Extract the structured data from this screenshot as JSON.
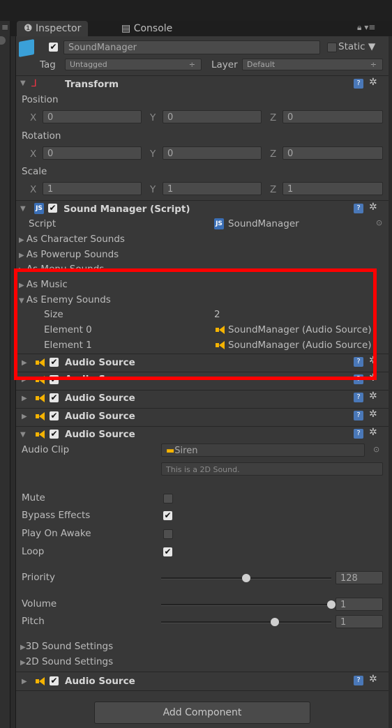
{
  "tabs": {
    "inspector": "Inspector",
    "console": "Console"
  },
  "window_icons": {
    "lock": "lock-icon",
    "menu": "menu-icon"
  },
  "gameobject": {
    "name": "SoundManager",
    "static_label": "Static",
    "tag_label": "Tag",
    "tag_value": "Untagged",
    "layer_label": "Layer",
    "layer_value": "Default"
  },
  "transform": {
    "title": "Transform",
    "position_label": "Position",
    "rotation_label": "Rotation",
    "scale_label": "Scale",
    "x": "X",
    "y": "Y",
    "z": "Z",
    "position": [
      "0",
      "0",
      "0"
    ],
    "rotation": [
      "0",
      "0",
      "0"
    ],
    "scale": [
      "1",
      "1",
      "1"
    ]
  },
  "script_component": {
    "title": "Sound Manager (Script)",
    "script_label": "Script",
    "script_value": "SoundManager",
    "js_badge": "JS",
    "items": [
      "As Character Sounds",
      "As Powerup Sounds",
      "As Menu Sounds",
      "As Music",
      "As Enemy Sounds"
    ],
    "size_label": "Size",
    "size_value": "2",
    "element0_label": "Element 0",
    "element0_value": "SoundManager (Audio Source)",
    "element1_label": "Element 1",
    "element1_value": "SoundManager (Audio Source)"
  },
  "audio_source_label": "Audio Source",
  "audio": {
    "clip_label": "Audio Clip",
    "clip_value": "Siren",
    "clip_note": "This is a 2D Sound.",
    "mute": "Mute",
    "bypass": "Bypass Effects",
    "play_on_awake": "Play On Awake",
    "loop": "Loop",
    "mute_checked": false,
    "bypass_checked": true,
    "play_on_awake_checked": false,
    "loop_checked": true,
    "priority_label": "Priority",
    "priority_value": "128",
    "volume_label": "Volume",
    "volume_value": "1",
    "pitch_label": "Pitch",
    "pitch_value": "1",
    "sound3d": "3D Sound Settings",
    "sound2d": "2D Sound Settings"
  },
  "slider_levels": {
    "priority": 0.5,
    "volume": 1.0,
    "pitch": 0.67
  },
  "add_component": "Add Component",
  "colors": {
    "highlight": "#ff0000",
    "speaker": "#f5b301",
    "panel": "#383838"
  }
}
